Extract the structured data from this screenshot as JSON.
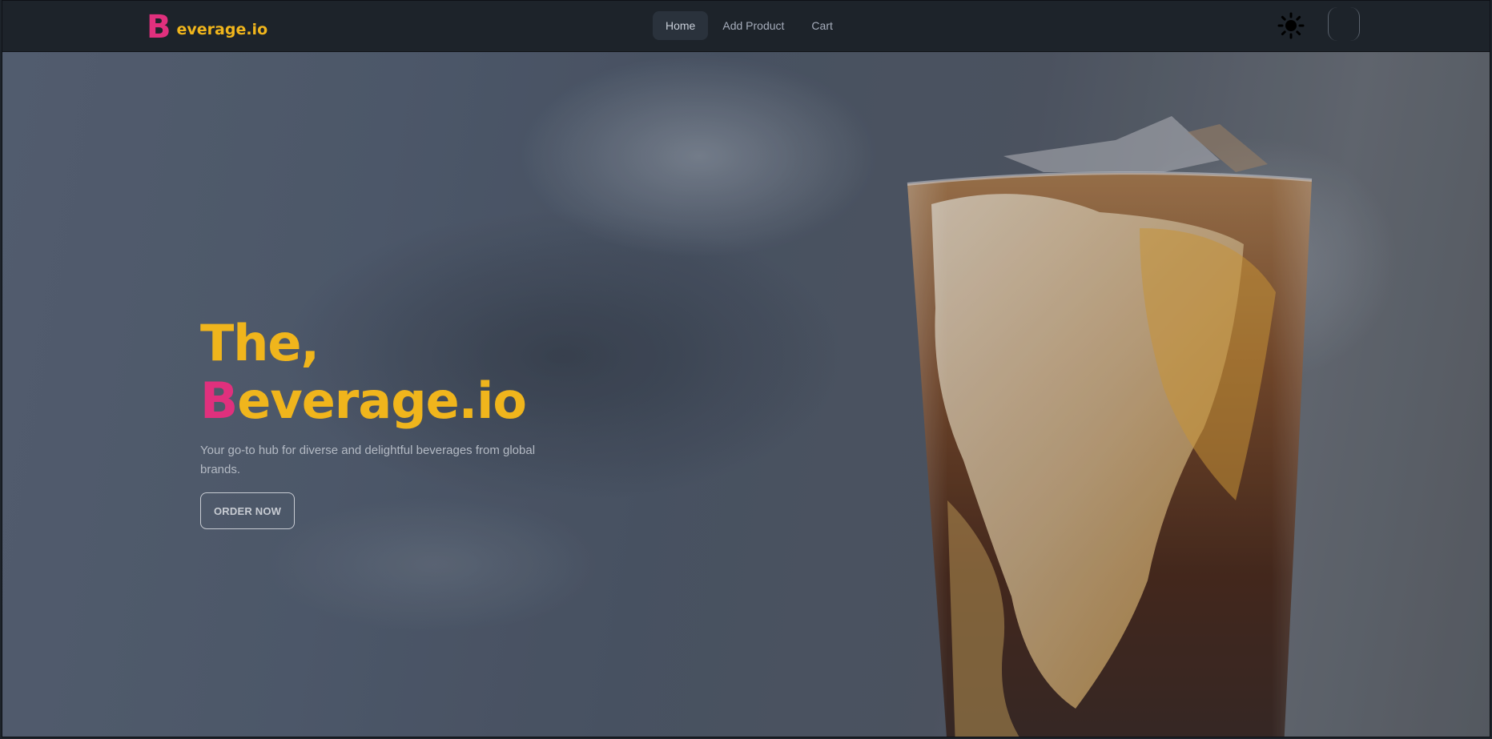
{
  "brand": {
    "initial": "B",
    "rest": "everage.io"
  },
  "nav": {
    "items": [
      {
        "label": "Home",
        "active": true
      },
      {
        "label": "Add Product",
        "active": false
      },
      {
        "label": "Cart",
        "active": false
      }
    ]
  },
  "header_icons": {
    "theme_toggle": "sun-icon"
  },
  "hero": {
    "title_line1": "The,",
    "title_initial": "B",
    "title_rest": "everage.io",
    "subtitle": "Your go-to hub for diverse and delightful beverages from global brands.",
    "cta_label": "ORDER NOW"
  },
  "colors": {
    "brand_pink": "#e0307d",
    "brand_yellow": "#f0b51c",
    "navbar_bg": "#1d232a"
  }
}
